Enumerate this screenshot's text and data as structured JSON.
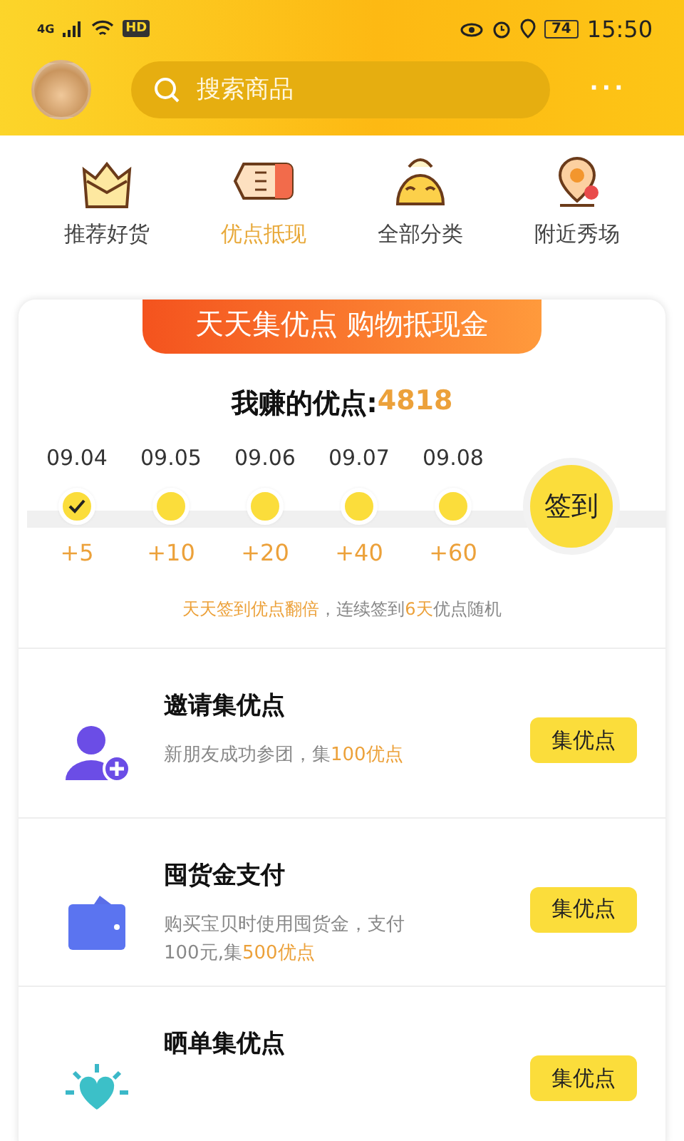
{
  "status_bar": {
    "network": "4G",
    "hd": "HD",
    "battery": "74",
    "time": "15:50"
  },
  "header": {
    "search": {
      "placeholder": "搜索商品"
    },
    "more": "···"
  },
  "nav": [
    {
      "label": "推荐好货",
      "selected": false,
      "kind": "crown"
    },
    {
      "label": "优点抵现",
      "selected": true,
      "kind": "coupon"
    },
    {
      "label": "全部分类",
      "selected": false,
      "kind": "bag"
    },
    {
      "label": "附近秀场",
      "selected": false,
      "kind": "pin"
    }
  ],
  "card": {
    "ribbon": "天天集优点 购物抵现金",
    "points_label": "我赚的优点:",
    "points_value": "4818",
    "days": [
      {
        "date": "09.04",
        "checked": true,
        "bonus": "+5"
      },
      {
        "date": "09.05",
        "checked": false,
        "bonus": "+10"
      },
      {
        "date": "09.06",
        "checked": false,
        "bonus": "+20"
      },
      {
        "date": "09.07",
        "checked": false,
        "bonus": "+40"
      },
      {
        "date": "09.08",
        "checked": false,
        "bonus": "+60"
      }
    ],
    "sign_button": "签到",
    "note": [
      {
        "text": "天天签到优点翻倍",
        "accent": true
      },
      {
        "text": "，连续签到",
        "accent": false
      },
      {
        "text": "6天",
        "accent": true
      },
      {
        "text": "优点随机",
        "accent": false
      }
    ],
    "tasks": [
      {
        "kind": "invite",
        "title": "邀请集优点",
        "desc": [
          {
            "text": "新朋友成功参团，集",
            "accent": false
          },
          {
            "text": "100优点",
            "accent": true
          }
        ],
        "button": "集优点"
      },
      {
        "kind": "wallet",
        "title": "囤货金支付",
        "desc": [
          {
            "text": "购买宝贝时使用囤货金，支付",
            "accent": false
          },
          {
            "text": "100元,集",
            "accent": false
          },
          {
            "text": "500优点",
            "accent": true
          }
        ],
        "button": "集优点"
      },
      {
        "kind": "share",
        "title": "晒单集优点",
        "button": "集优点"
      }
    ]
  }
}
